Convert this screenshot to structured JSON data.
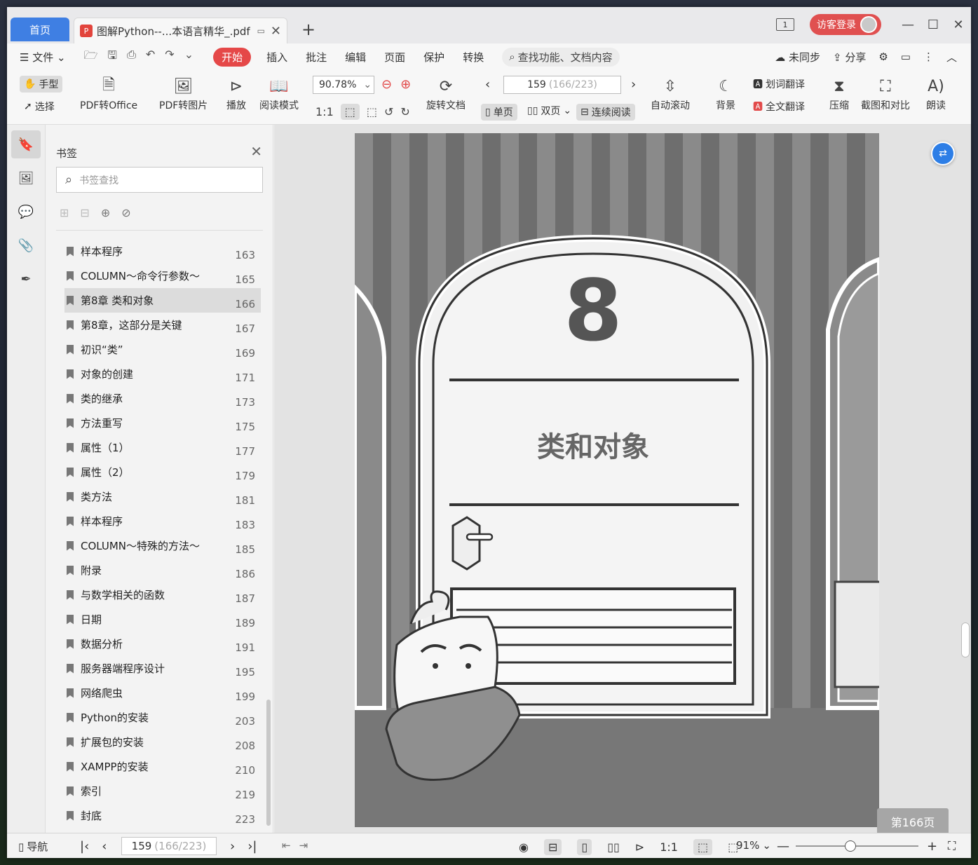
{
  "titlebar": {
    "home_tab": "首页",
    "doc_tab_title": "图解Python--...本语言精华_.pdf",
    "page_indicator": "1",
    "login": "访客登录"
  },
  "menubar": {
    "file": "文件",
    "items": [
      "开始",
      "插入",
      "批注",
      "编辑",
      "页面",
      "保护",
      "转换"
    ],
    "search": "查找功能、文档内容",
    "sync": "未同步",
    "share": "分享"
  },
  "ribbon": {
    "hand": "手型",
    "select": "选择",
    "pdf_to_office": "PDF转Office",
    "pdf_to_image": "PDF转图片",
    "play": "播放",
    "read_mode": "阅读模式",
    "zoom": "90.78%",
    "page_current": "159",
    "page_total": "(166/223)",
    "rotate_doc": "旋转文档",
    "single": "单页",
    "double": "双页",
    "continuous": "连续阅读",
    "auto_scroll": "自动滚动",
    "background": "背景",
    "word_translate": "划词翻译",
    "full_translate": "全文翻译",
    "compress": "压缩",
    "screenshot_compare": "截图和对比",
    "read_aloud": "朗读"
  },
  "bookmarks": {
    "title": "书签",
    "search_placeholder": "书签查找",
    "items": [
      {
        "label": "样本程序",
        "page": "163"
      },
      {
        "label": "COLUMN～命令行参数～",
        "page": "165"
      },
      {
        "label": "第8章  类和对象",
        "page": "166"
      },
      {
        "label": "第8章，这部分是关键",
        "page": "167"
      },
      {
        "label": "初识“类”",
        "page": "169"
      },
      {
        "label": "对象的创建",
        "page": "171"
      },
      {
        "label": "类的继承",
        "page": "173"
      },
      {
        "label": "方法重写",
        "page": "175"
      },
      {
        "label": "属性（1）",
        "page": "177"
      },
      {
        "label": "属性（2）",
        "page": "179"
      },
      {
        "label": "类方法",
        "page": "181"
      },
      {
        "label": "样本程序",
        "page": "183"
      },
      {
        "label": "COLUMN～特殊的方法～",
        "page": "185"
      },
      {
        "label": "附录",
        "page": "186"
      },
      {
        "label": "与数学相关的函数",
        "page": "187"
      },
      {
        "label": "日期",
        "page": "189"
      },
      {
        "label": "数据分析",
        "page": "191"
      },
      {
        "label": "服务器端程序设计",
        "page": "195"
      },
      {
        "label": "网络爬虫",
        "page": "199"
      },
      {
        "label": "Python的安装",
        "page": "203"
      },
      {
        "label": "扩展包的安装",
        "page": "208"
      },
      {
        "label": "XAMPP的安装",
        "page": "210"
      },
      {
        "label": "索引",
        "page": "219"
      },
      {
        "label": "封底",
        "page": "223"
      }
    ],
    "selected_index": 2
  },
  "page_content": {
    "chapter_number": "8",
    "chapter_title": "类和对象",
    "page_badge": "第166页"
  },
  "statusbar": {
    "nav": "导航",
    "page_current": "159",
    "page_total": "(166/223)",
    "zoom": "91%"
  }
}
